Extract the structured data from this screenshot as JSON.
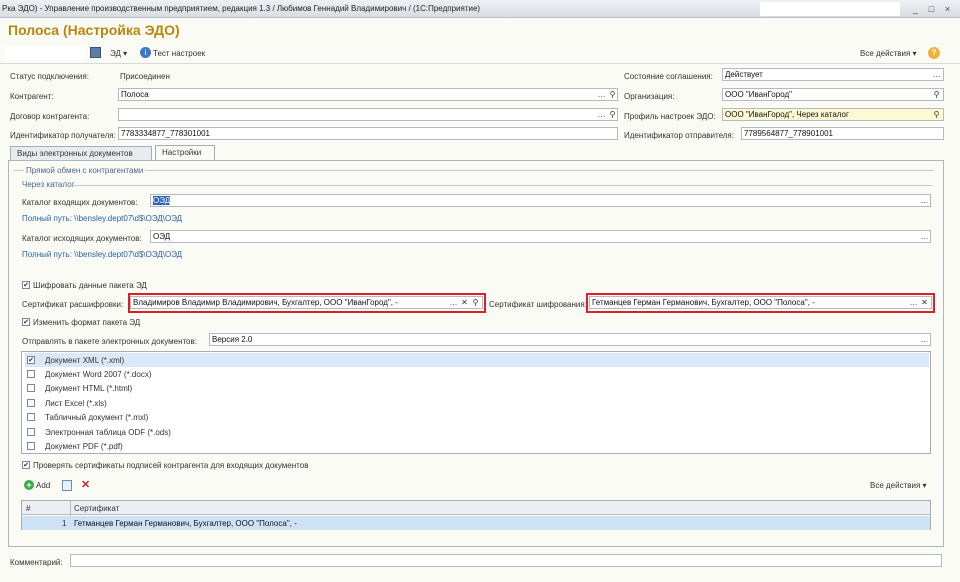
{
  "window": {
    "title": "Рка ЭДО) - Управление производственным предприятием, редакция 1.3 / Любимов Геннадий Владимирович /   (1С:Предприятие)",
    "min": "_",
    "max": "□",
    "close": "×"
  },
  "form": {
    "title": "Полоса (Настройка ЭДО)"
  },
  "toolbar": {
    "ed_label": "ЭД ▾",
    "test_label": "Тест настроек",
    "all_actions": "Все действия ▾",
    "help": "?"
  },
  "header": {
    "status_label": "Статус подключения:",
    "status_value": "Присоединен",
    "counterparty_label": "Контрагент:",
    "counterparty_value": "Полоса",
    "contract_label": "Договор контрагента:",
    "contract_value": "",
    "receiver_id_label": "Идентификатор получателя:",
    "receiver_id_value": "7783334877_778301001",
    "agreement_label": "Состояние соглашения:",
    "agreement_value": "Действует",
    "organization_label": "Организация:",
    "organization_value": "ООО \"ИванГород\"",
    "profile_label": "Профиль настроек ЭДО:",
    "profile_value": "ООО \"ИванГород\", Через каталог",
    "sender_id_label": "Идентификатор отправителя:",
    "sender_id_value": "7789564877_778901001"
  },
  "tabs": [
    {
      "label": "Виды электронных документов"
    },
    {
      "label": "Настройки"
    }
  ],
  "settings": {
    "group_title": "Прямой обмен с контрагентами",
    "subgroup_title": "Через каталог",
    "incoming_label": "Каталог входящих документов:",
    "incoming_value": "ОЭД",
    "incoming_path": "Полный путь: \\\\bensley.dept07\\d$\\ОЭД\\ОЭД",
    "outgoing_label": "Каталог исходящих документов:",
    "outgoing_value": "ОЭД",
    "outgoing_path": "Полный путь: \\\\bensley.dept07\\d$\\ОЭД\\ОЭД",
    "encrypt_label": "Шифровать данные пакета ЭД",
    "decrypt_cert_label": "Сертификат расшифровки:",
    "decrypt_cert_value": "Владимиров Владимир Владимирович, Бухгалтер, ООО \"ИванГород\", -",
    "encrypt_cert_label": "Сертификат шифрования:",
    "encrypt_cert_value": "Гетманцев Герман Германович, Бухгалтер, ООО \"Полоса\", -",
    "change_format_label": "Изменить формат пакета ЭД",
    "send_label": "Отправлять в пакете электронных документов:",
    "send_value": "Версия 2.0",
    "formats": [
      {
        "label": "Документ XML (*.xml)",
        "checked": true
      },
      {
        "label": "Документ Word 2007 (*.docx)",
        "checked": false
      },
      {
        "label": "Документ HTML (*.html)",
        "checked": false
      },
      {
        "label": "Лист Excel (*.xls)",
        "checked": false
      },
      {
        "label": "Табличный документ (*.mxl)",
        "checked": false
      },
      {
        "label": "Электронная таблица ODF (*.ods)",
        "checked": false
      },
      {
        "label": "Документ PDF (*.pdf)",
        "checked": false
      }
    ],
    "verify_label": "Проверять сертификаты подписей контрагента для входящих документов",
    "add_label": "Add",
    "all_actions": "Все действия ▾",
    "grid": {
      "col_num": "#",
      "col_cert": "Сертификат",
      "rows": [
        {
          "num": "1",
          "cert": "Гетманцев Герман Германович, Бухгалтер, ООО \"Полоса\", -"
        }
      ]
    }
  },
  "footer": {
    "comment_label": "Комментарий:",
    "comment_value": ""
  }
}
